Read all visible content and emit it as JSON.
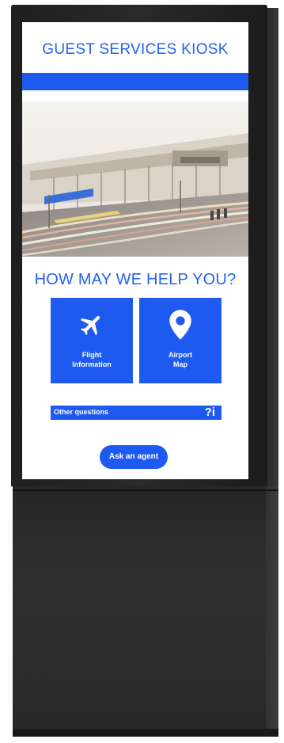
{
  "header": {
    "title": "GUEST SERVICES KIOSK"
  },
  "hero": {
    "image": "airport-terminal-photo"
  },
  "main": {
    "heading": "HOW MAY WE HELP YOU?",
    "tiles": [
      {
        "label": "Flight\nInformation",
        "icon": "airplane-icon"
      },
      {
        "label": "Airport\nMap",
        "icon": "map-pin-icon"
      }
    ],
    "other": {
      "label": "Other questions",
      "icon_text": "?i"
    },
    "agent_button": "Ask an agent"
  },
  "colors": {
    "accent": "#1f5af0",
    "heading": "#2563eb",
    "kiosk_body": "#262626"
  }
}
